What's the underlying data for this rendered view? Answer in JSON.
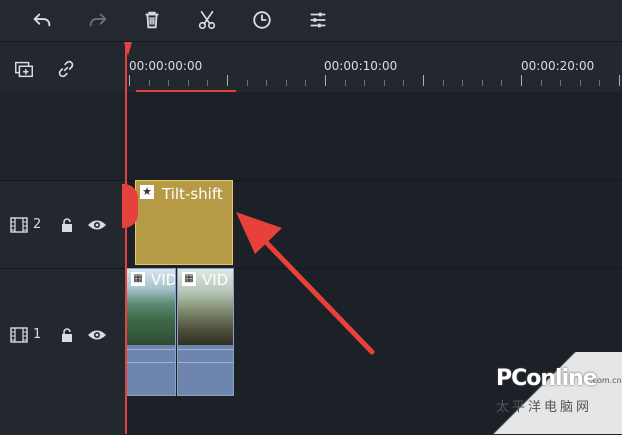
{
  "toolbar": {
    "undo_icon": "undo-icon",
    "redo_icon": "redo-icon",
    "delete_icon": "trash-icon",
    "cut_icon": "scissors-icon",
    "duration_icon": "clock-icon",
    "adjust_icon": "sliders-icon"
  },
  "header": {
    "add_track_icon": "add-track-icon",
    "link_icon": "link-icon"
  },
  "ruler": {
    "timecodes": [
      "00:00:00:00",
      "00:00:10:00",
      "00:00:20:00"
    ]
  },
  "tracks": [
    {
      "number": "2",
      "clip": {
        "type": "effect",
        "label": "Tilt-shift"
      }
    },
    {
      "number": "1",
      "clips": [
        {
          "label": "VID"
        },
        {
          "label": "VID"
        }
      ]
    }
  ],
  "colors": {
    "playhead": "#e3423f",
    "effect_clip": "#b69a45",
    "video_clip": "#6e86ad",
    "arrow": "#e8403a"
  },
  "watermark": {
    "logo": "PConline",
    "sub": ".com.cn",
    "cn": "太平洋电脑网"
  }
}
